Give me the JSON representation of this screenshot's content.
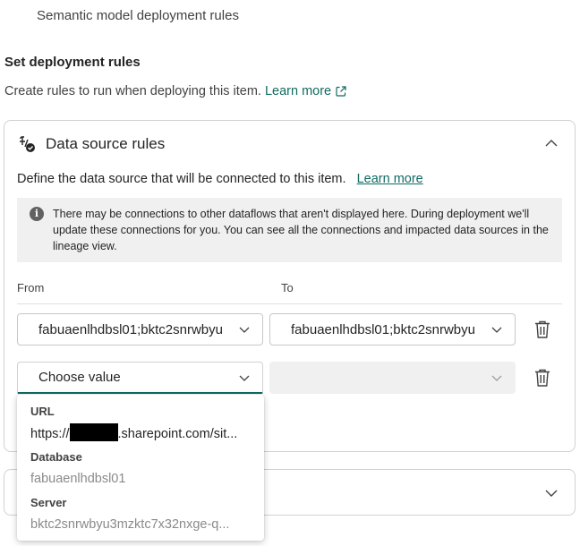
{
  "page": {
    "top_title": "Semantic model deployment rules",
    "section_heading": "Set deployment rules",
    "section_desc": "Create rules to run when deploying this item.",
    "section_learn_more": "Learn more"
  },
  "data_source_card": {
    "title": "Data source rules",
    "description": "Define the data source that will be connected to this item.",
    "learn_more": "Learn more",
    "info_text": "There may be connections to other dataflows that aren't displayed here. During deployment we'll update these connections for you. You can see all the connections and impacted data sources in the lineage view.",
    "from_label": "From",
    "to_label": "To",
    "rule1": {
      "from_value": "fabuaenlhdbsl01;bktc2snrwbyu",
      "to_value": "fabuaenlhdbsl01;bktc2snrwbyu"
    },
    "rule2": {
      "from_placeholder": "Choose value",
      "to_value": ""
    }
  },
  "popup": {
    "url_label": "URL",
    "url_prefix": "https://",
    "url_suffix": ".sharepoint.com/sit...",
    "database_label": "Database",
    "database_value": "fabuaenlhdbsl01",
    "server_label": "Server",
    "server_value": "bktc2snrwbyu3mzktc7x32nxge-q..."
  },
  "icons": {
    "external_link": "external-link-icon",
    "data_source": "data-source-icon",
    "info": "info-icon",
    "chevron_up": "chevron-up-icon",
    "chevron_down": "chevron-down-icon",
    "trash": "trash-icon"
  },
  "colors": {
    "accent": "#0f6b62",
    "info_bg": "#f0f0f0",
    "border": "#d1d1d1"
  }
}
